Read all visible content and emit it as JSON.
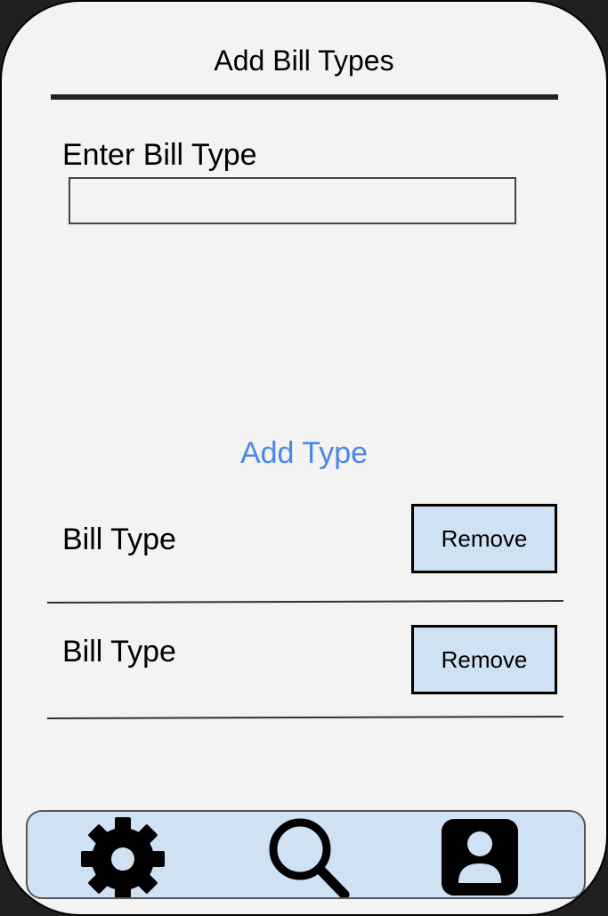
{
  "header": {
    "title": "Add Bill Types"
  },
  "form": {
    "label": "Enter Bill Type",
    "input_value": "",
    "input_placeholder": ""
  },
  "actions": {
    "add_type_label": "Add Type"
  },
  "bill_types": [
    {
      "label": "Bill Type",
      "remove_label": "Remove"
    },
    {
      "label": "Bill Type",
      "remove_label": "Remove"
    }
  ],
  "bottom_nav": {
    "items": [
      {
        "icon": "gear-icon"
      },
      {
        "icon": "search-icon"
      },
      {
        "icon": "user-icon"
      }
    ]
  },
  "colors": {
    "background": "#f3f3f3",
    "link": "#4a86e8",
    "button_fill": "#cfe2f3",
    "nav_fill": "#cfe2f3",
    "frame": "#202020"
  }
}
